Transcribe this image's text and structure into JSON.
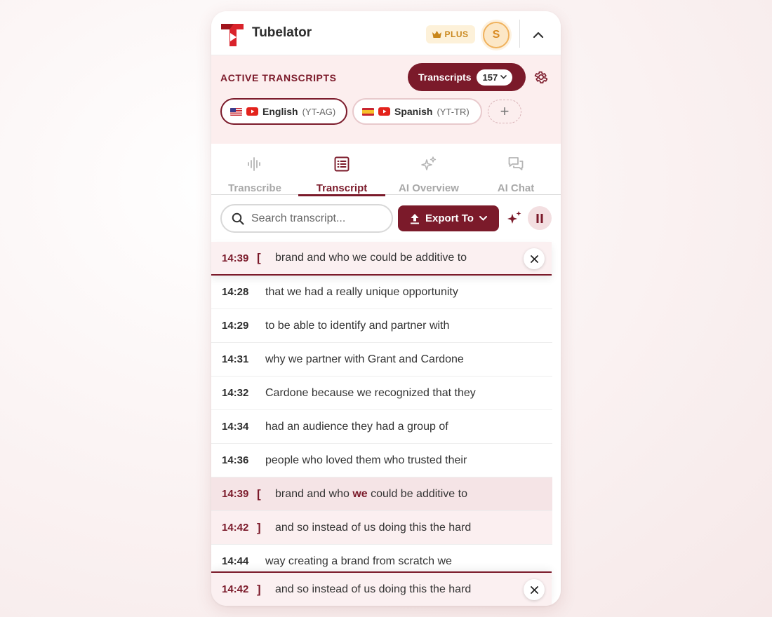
{
  "app": {
    "title": "Tubelator",
    "plus_label": "PLUS",
    "avatar_letter": "S"
  },
  "colors": {
    "brand": "#7b1a2a",
    "plus_gold": "#c9871c",
    "panel_tint": "#fceeee"
  },
  "active": {
    "title": "ACTIVE TRANSCRIPTS",
    "transcripts_label": "Transcripts",
    "transcripts_count": "157",
    "languages": [
      {
        "name": "English",
        "code": "(YT-AG)",
        "flag": "us-flag-icon",
        "active": true
      },
      {
        "name": "Spanish",
        "code": "(YT-TR)",
        "flag": "es-flag-icon",
        "active": false
      }
    ],
    "add_label": "+"
  },
  "tabs": [
    {
      "label": "Transcribe",
      "icon": "waveform-icon",
      "active": false
    },
    {
      "label": "Transcript",
      "icon": "document-list-icon",
      "active": true
    },
    {
      "label": "AI Overview",
      "icon": "sparkles-icon",
      "active": false
    },
    {
      "label": "AI Chat",
      "icon": "chat-bubbles-icon",
      "active": false
    }
  ],
  "toolbar": {
    "search_placeholder": "Search transcript...",
    "export_label": "Export To"
  },
  "pinned_top": {
    "time": "14:39",
    "bracket": "[",
    "text": "brand and who we could be additive to"
  },
  "pinned_bottom": {
    "time": "14:42",
    "bracket": "]",
    "text": "and so instead of us doing this the hard"
  },
  "rows": [
    {
      "time": "14:28",
      "text": "that we had a really unique opportunity"
    },
    {
      "time": "14:29",
      "text": "to be able to identify and partner with"
    },
    {
      "time": "14:31",
      "text": "why we partner with Grant and Cardone"
    },
    {
      "time": "14:32",
      "text": "Cardone because we recognized that they"
    },
    {
      "time": "14:34",
      "text": "had an audience they had a group of"
    },
    {
      "time": "14:36",
      "text": "people who loved them who trusted their"
    },
    {
      "time": "14:39",
      "bracket": "[",
      "pre": "brand and who ",
      "kw": "we",
      "post": " could be additive to"
    },
    {
      "time": "14:42",
      "bracket": "]",
      "text": "and so instead of us doing this the hard"
    },
    {
      "time": "14:44",
      "text": "way creating a brand from scratch we"
    }
  ]
}
